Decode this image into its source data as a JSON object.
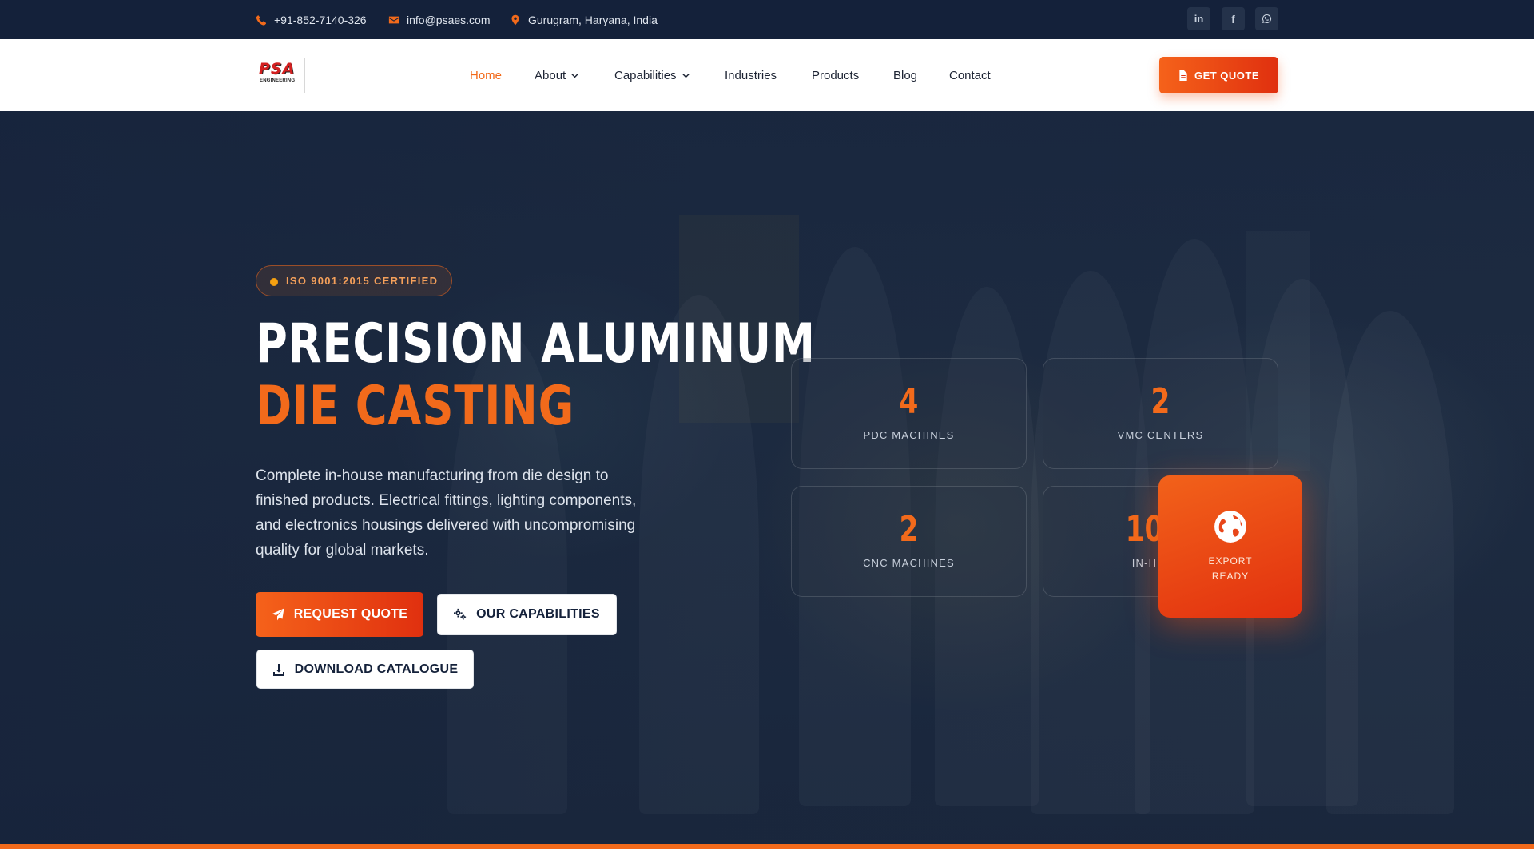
{
  "topbar": {
    "phone": "+91-852-7140-326",
    "email": "info@psaes.com",
    "location": "Gurugram, Haryana, India",
    "social": [
      "linkedin-icon",
      "facebook-icon",
      "whatsapp-icon"
    ]
  },
  "brand": {
    "logo_text": "PSA",
    "logo_sub": "ENGINEERING"
  },
  "nav": {
    "items": [
      {
        "label": "Home",
        "active": true
      },
      {
        "label": "About",
        "dropdown": true
      },
      {
        "label": "Capabilities",
        "dropdown": true
      },
      {
        "label": "Industries"
      },
      {
        "label": "Products"
      },
      {
        "label": "Blog"
      },
      {
        "label": "Contact"
      }
    ],
    "cta": "GET QUOTE"
  },
  "hero": {
    "badge": "ISO 9001:2015 CERTIFIED",
    "title_line1": "PRECISION ALUMINUM",
    "title_line2": "DIE CASTING",
    "description": "Complete in-house manufacturing from die design to finished products. Electrical fittings, lighting components, and electronics housings delivered with uncompromising quality for global markets.",
    "buttons": {
      "request": "REQUEST QUOTE",
      "capabilities": "OUR CAPABILITIES",
      "catalogue": "DOWNLOAD CATALOGUE"
    },
    "stats": [
      {
        "value": "4",
        "label": "PDC MACHINES"
      },
      {
        "value": "2",
        "label": "VMC CENTERS"
      },
      {
        "value": "2",
        "label": "CNC MACHINES"
      },
      {
        "value": "10",
        "label": "IN-H"
      }
    ],
    "export": {
      "line1": "EXPORT",
      "line2": "READY"
    }
  },
  "colors": {
    "accent": "#f26a1b",
    "navy": "#14213a",
    "white": "#ffffff"
  }
}
